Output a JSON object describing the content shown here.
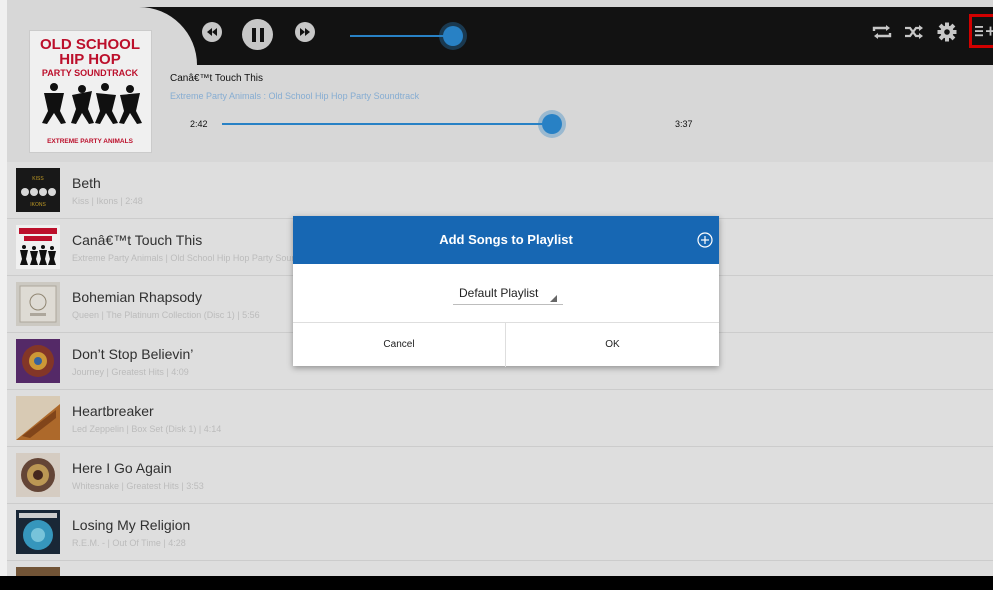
{
  "player": {
    "album_title_line1": "OLD SCHOOL",
    "album_title_line2": "HIP HOP",
    "album_title_line3": "PARTY SOUNDTRACK",
    "album_footer": "EXTREME PARTY ANIMALS",
    "track_title": "Canâ€™t Touch This",
    "track_subtitle": "Extreme Party Animals : Old School Hip Hop Party Soundtrack",
    "position": "2:42",
    "duration": "3:37",
    "progress_fraction": 0.746,
    "volume_fraction": 0.95,
    "state": "playing"
  },
  "toolbar": {
    "rewind_icon": "rewind-icon",
    "pause_icon": "pause-icon",
    "fast_forward_icon": "fast-forward-icon",
    "repeat_icon": "repeat-icon",
    "shuffle_icon": "shuffle-icon",
    "settings_icon": "gear-icon",
    "add_to_playlist_icon": "add-to-playlist-icon",
    "highlight_color": "#e00000"
  },
  "songs": [
    {
      "title": "Beth",
      "subtitle": "Kiss | Ikons | 2:48",
      "art": "art-ikons"
    },
    {
      "title": "Canâ€™t Touch This",
      "subtitle": "Extreme Party Animals | Old School Hip Hop Party Soundtrack | 3:37",
      "art": "art-oldschool"
    },
    {
      "title": "Bohemian Rhapsody",
      "subtitle": "Queen | The Platinum Collection (Disc 1) | 5:56",
      "art": "art-queen"
    },
    {
      "title": "Don’t Stop Believin’",
      "subtitle": "Journey | Greatest Hits | 4:09",
      "art": "art-journey"
    },
    {
      "title": "Heartbreaker",
      "subtitle": "Led Zeppelin | Box Set (Disk 1) | 4:14",
      "art": "art-ledzep"
    },
    {
      "title": "Here I Go Again",
      "subtitle": "Whitesnake | Greatest Hits | 3:53",
      "art": "art-whitesnake"
    },
    {
      "title": "Losing My Religion",
      "subtitle": "R.E.M. - | Out Of Time | 4:28",
      "art": "art-rem"
    }
  ],
  "dialog": {
    "title": "Add Songs to Playlist",
    "selected_playlist": "Default Playlist",
    "cancel_label": "Cancel",
    "ok_label": "OK"
  },
  "colors": {
    "accent": "#2b8ad2",
    "dialog_header": "#1767b3",
    "topbar": "#141414"
  }
}
